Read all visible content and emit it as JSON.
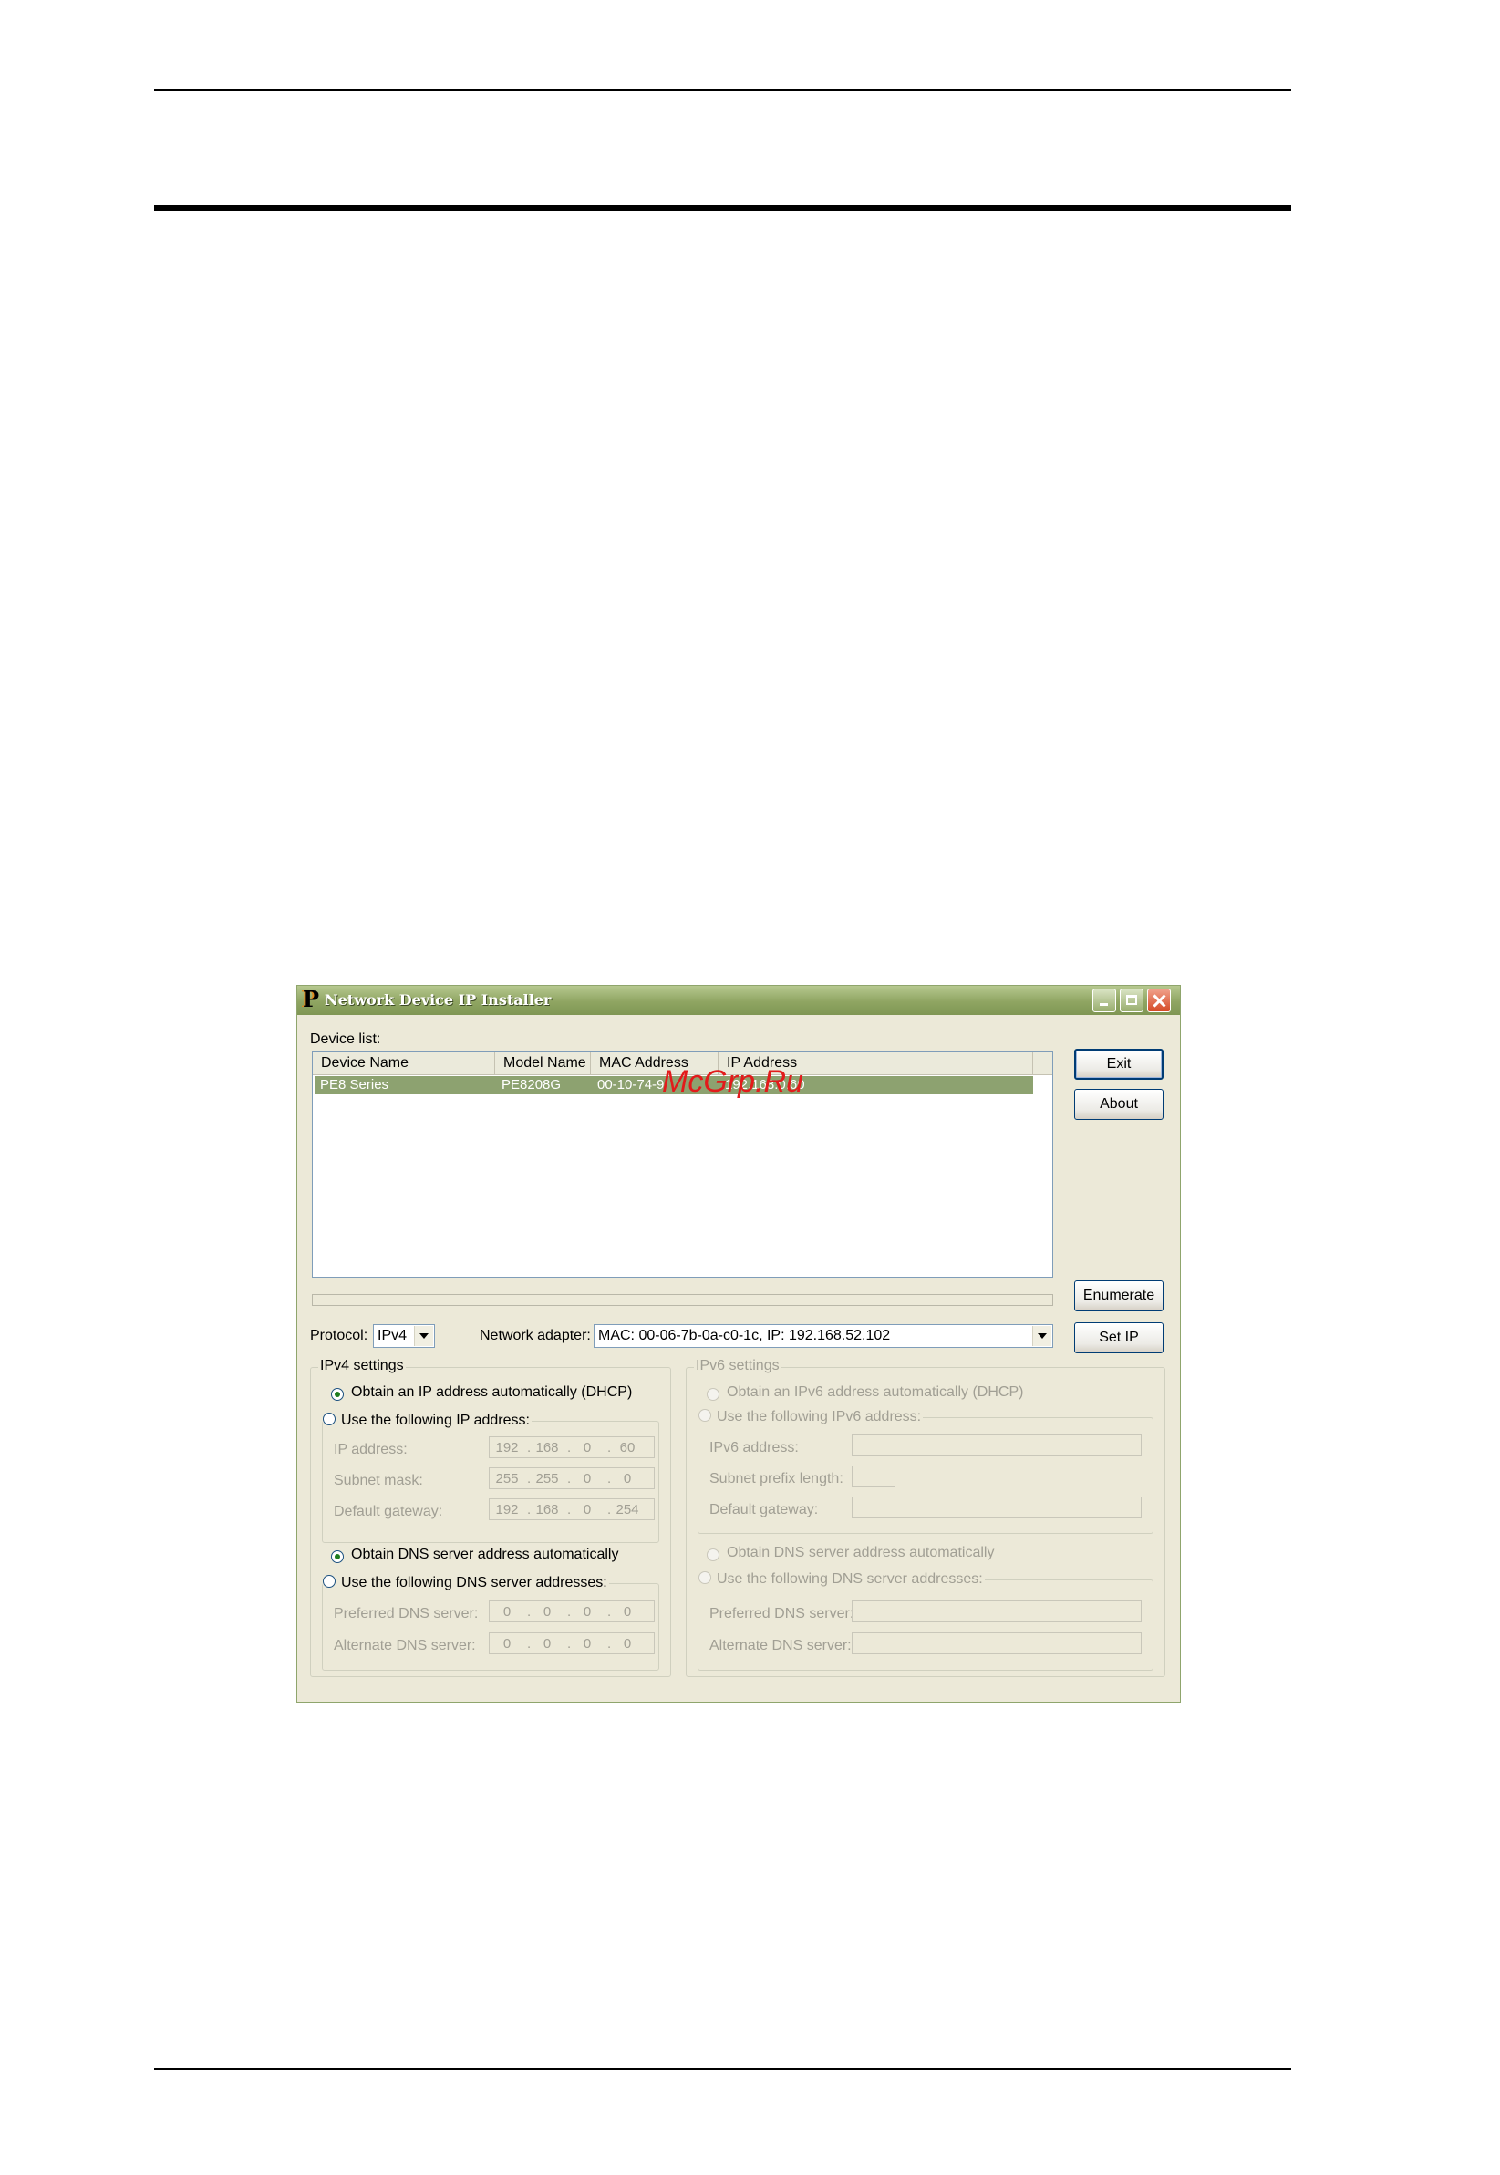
{
  "window": {
    "title": "Network Device IP Installer"
  },
  "device_list": {
    "label": "Device list:",
    "columns": [
      "Device Name",
      "Model Name",
      "MAC Address",
      "IP Address"
    ],
    "rows": [
      {
        "device_name": "PE8 Series",
        "model_name": "PE8208G",
        "mac_address": "00-10-74-9",
        "ip_address": "192.168.0.60"
      }
    ]
  },
  "buttons": {
    "exit": "Exit",
    "about": "About",
    "enumerate": "Enumerate",
    "set_ip": "Set IP"
  },
  "protocol": {
    "label": "Protocol:",
    "value": "IPv4"
  },
  "network_adapter": {
    "label": "Network adapter:",
    "value": "MAC: 00-06-7b-0a-c0-1c,   IP: 192.168.52.102"
  },
  "ipv4": {
    "title": "IPv4 settings",
    "dhcp_label": "Obtain an IP address automatically (DHCP)",
    "static_label": "Use the following IP address:",
    "ip_label": "IP address:",
    "ip_value": [
      "192",
      "168",
      "0",
      "60"
    ],
    "mask_label": "Subnet mask:",
    "mask_value": [
      "255",
      "255",
      "0",
      "0"
    ],
    "gateway_label": "Default gateway:",
    "gateway_value": [
      "192",
      "168",
      "0",
      "254"
    ],
    "dns_auto_label": "Obtain DNS server address automatically",
    "dns_static_label": "Use the following DNS server addresses:",
    "pref_dns_label": "Preferred DNS server:",
    "pref_dns_value": [
      "0",
      "0",
      "0",
      "0"
    ],
    "alt_dns_label": "Alternate DNS server:",
    "alt_dns_value": [
      "0",
      "0",
      "0",
      "0"
    ]
  },
  "ipv6": {
    "title": "IPv6 settings",
    "dhcp_label": "Obtain an IPv6 address automatically (DHCP)",
    "static_label": "Use the following IPv6 address:",
    "ip_label": "IPv6 address:",
    "prefix_label": "Subnet prefix length:",
    "gateway_label": "Default gateway:",
    "dns_auto_label": "Obtain DNS server address automatically",
    "dns_static_label": "Use the following DNS server addresses:",
    "pref_dns_label": "Preferred DNS server:",
    "alt_dns_label": "Alternate DNS server:"
  },
  "watermark": "McGrp.Ru",
  "colors": {
    "selection": "#8da270",
    "titlebar": "#8fa562",
    "watermark": "#e21b1b"
  }
}
